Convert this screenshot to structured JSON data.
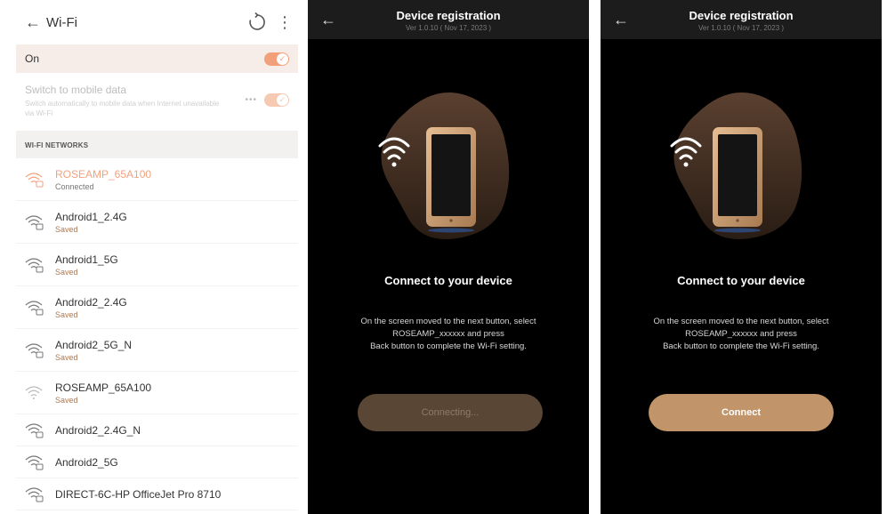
{
  "wifi": {
    "title": "Wi-Fi",
    "on_label": "On",
    "mobile_data": {
      "title": "Switch to mobile data",
      "description": "Switch automatically to mobile data when Internet unavailable via Wi-Fi",
      "dots": "•••"
    },
    "section_header": "WI-FI NETWORKS",
    "networks": [
      {
        "name": "ROSEAMP_65A100",
        "status": "Connected"
      },
      {
        "name": "Android1_2.4G",
        "status": "Saved"
      },
      {
        "name": "Android1_5G",
        "status": "Saved"
      },
      {
        "name": "Android2_2.4G",
        "status": "Saved"
      },
      {
        "name": "Android2_5G_N",
        "status": "Saved"
      },
      {
        "name": "ROSEAMP_65A100",
        "status": "Saved"
      },
      {
        "name": "Android2_2.4G_N",
        "status": ""
      },
      {
        "name": "Android2_5G",
        "status": ""
      },
      {
        "name": "DIRECT-6C-HP OfficeJet Pro 8710",
        "status": ""
      }
    ]
  },
  "registration_left": {
    "title": "Device registration",
    "version": "Ver 1.0.10 ( Nov 17, 2023 )",
    "heading": "Connect to your device",
    "desc_line1": "On the screen moved to the next button, select",
    "desc_line2": "ROSEAMP_xxxxxx and press",
    "desc_line3": "Back button to complete the Wi-Fi setting.",
    "button_label": "Connecting..."
  },
  "registration_right": {
    "title": "Device registration",
    "version": "Ver 1.0.10 ( Nov 17, 2023 )",
    "heading": "Connect to your device",
    "desc_line1": "On the screen moved to the next button, select",
    "desc_line2": "ROSEAMP_xxxxxx and press",
    "desc_line3": "Back button to complete the Wi-Fi setting.",
    "button_label": "Connect"
  },
  "icons": {
    "back": "back-arrow-icon",
    "refresh": "refresh-icon",
    "more": "more-vertical-icon",
    "wifi": "wifi-lock-icon",
    "phone": "phone-illustration"
  },
  "colors": {
    "accent": "#f2a07a",
    "connected_text": "#f3a27f",
    "connect_button": "#c19469",
    "connecting_button": "#5a4634",
    "dark_bg": "#000000",
    "dark_bar": "#1c1c1c"
  }
}
